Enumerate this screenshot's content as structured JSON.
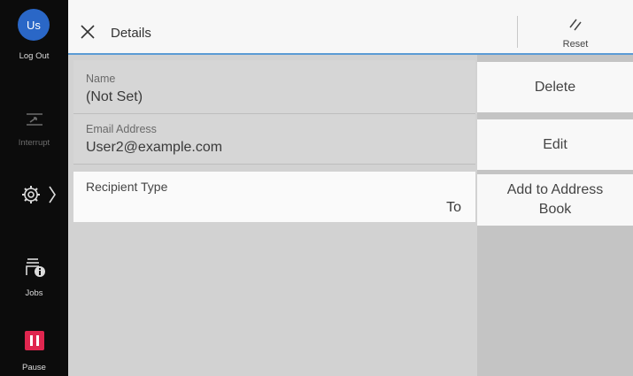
{
  "sidebar": {
    "avatar_text": "Us",
    "logout_label": "Log Out",
    "interrupt_label": "Interrupt",
    "jobs_label": "Jobs",
    "pause_label": "Pause",
    "accent_pause": "#e0264f",
    "accent_avatar": "#2a67c7"
  },
  "header": {
    "title": "Details",
    "reset_label": "Reset",
    "icon_close": "close-icon",
    "icon_reset": "reset-icon"
  },
  "details": {
    "name_label": "Name",
    "name_value": "(Not Set)",
    "email_label": "Email Address",
    "email_value": "User2@example.com",
    "recipient_type_label": "Recipient Type",
    "recipient_type_value": "To"
  },
  "actions": {
    "delete_label": "Delete",
    "edit_label": "Edit",
    "add_to_address_book_label": "Add to Address Book"
  }
}
